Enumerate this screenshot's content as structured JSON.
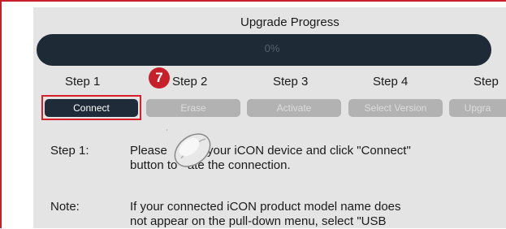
{
  "window": {
    "title": "Upgrade Progress"
  },
  "progress": {
    "value_text": "0%",
    "fraction": 0
  },
  "steps": [
    {
      "label": "Step 1"
    },
    {
      "label": "Step 2"
    },
    {
      "label": "Step 3"
    },
    {
      "label": "Step 4"
    },
    {
      "label": "Step"
    }
  ],
  "buttons": {
    "connect": "Connect",
    "erase": "Erase",
    "activate": "Activate",
    "select_version": "Select Version",
    "upgrade": "Upgra"
  },
  "annotation": {
    "marker_number": "7"
  },
  "instructions": {
    "step_label": "Step 1:",
    "step_text_line1": "Please        ct your iCON device and click \"Connect\"",
    "step_text_line2": "button to   ate the connection.",
    "note_label": "Note:",
    "note_text_line1": "If your connected iCON product model name does",
    "note_text_line2": "not appear on the pull-down menu, select \"USB"
  },
  "colors": {
    "frame_border": "#c8202a",
    "panel_bg": "#e4e4e4",
    "progress_track": "#1e2b36",
    "active_button": "#1f2b38",
    "disabled_button": "#b2b2b2",
    "highlight_border": "#d8202a"
  }
}
